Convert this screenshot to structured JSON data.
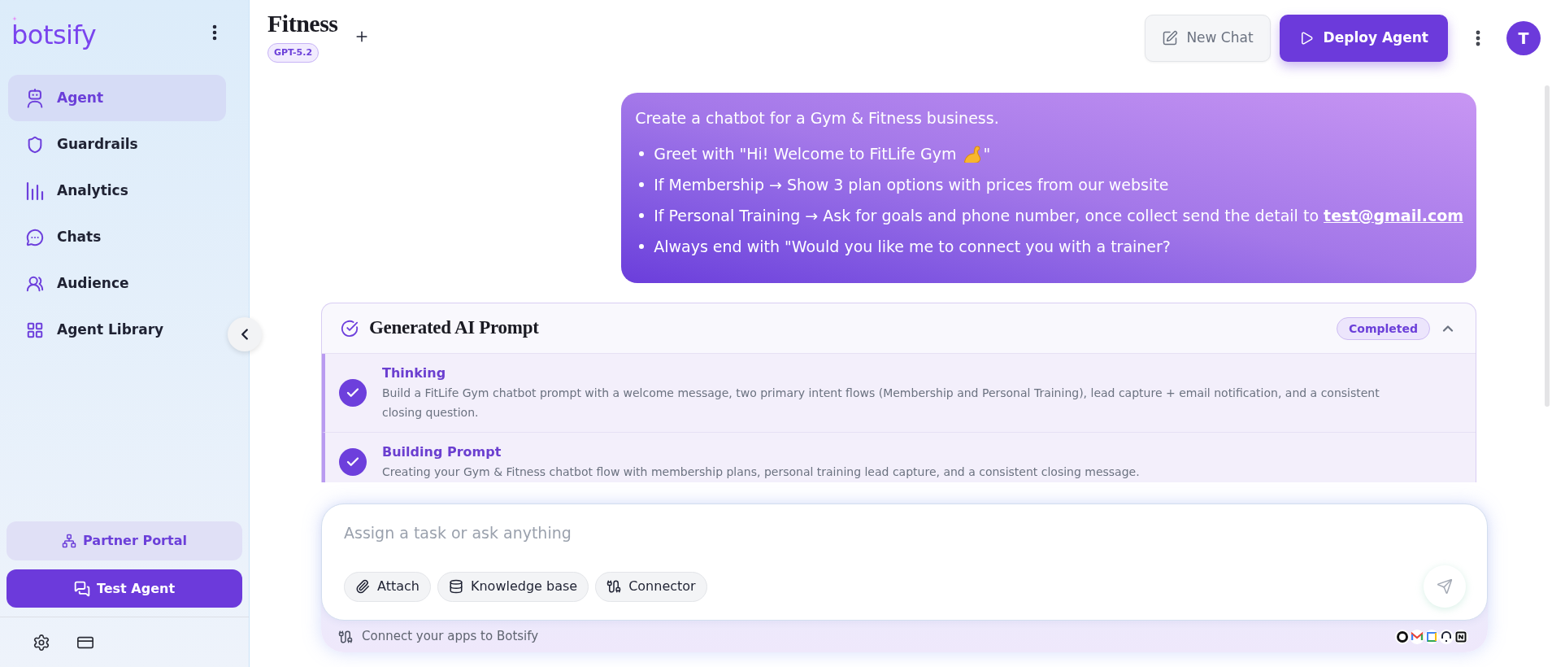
{
  "sidebar": {
    "logo": "botsify",
    "nav": [
      {
        "label": "Agent",
        "kind": "agent",
        "selected": true
      },
      {
        "label": "Guardrails",
        "kind": "guardrails",
        "selected": false
      },
      {
        "label": "Analytics",
        "kind": "analytics",
        "selected": false
      },
      {
        "label": "Chats",
        "kind": "chats",
        "selected": false
      },
      {
        "label": "Audience",
        "kind": "audience",
        "selected": false
      },
      {
        "label": "Agent Library",
        "kind": "library",
        "selected": false
      }
    ],
    "partner_button": "Partner Portal",
    "test_button": "Test Agent"
  },
  "header": {
    "title": "Fitness",
    "model": "GPT-5.2",
    "actions": [
      {
        "label": "New Chat",
        "kind": "secondary"
      },
      {
        "label": "Deploy Agent",
        "kind": "primary"
      }
    ],
    "avatar": "T"
  },
  "message": {
    "intro": "Create a chatbot for a Gym & Fitness business.",
    "bullets": [
      {
        "kind": "emoji",
        "text": "Greet with \"Hi! Welcome to FitLife Gym",
        "after": "\""
      },
      {
        "kind": "plain",
        "text": "If Membership → Show 3 plan options with prices from our website"
      },
      {
        "kind": "link",
        "text": "If Personal Training → Ask for goals and phone number, once collect send the detail to",
        "link": "test@gmail.com"
      },
      {
        "kind": "plain",
        "text": "Always end with \"Would you like me to connect you with a trainer?"
      }
    ]
  },
  "prompt_card": {
    "title": "Generated AI Prompt",
    "status": "Completed",
    "expanded": true,
    "steps": [
      {
        "title": "Thinking",
        "description": "Build a FitLife Gym chatbot prompt with a welcome message, two primary intent flows (Membership and Personal Training), lead capture + email notification, and a consistent closing question.",
        "done": true
      },
      {
        "title": "Building Prompt",
        "description": "Creating your Gym & Fitness chatbot flow with membership plans, personal training lead capture, and a consistent closing message.",
        "done": true
      }
    ]
  },
  "composer": {
    "placeholder": "Assign a task or ask anything",
    "chips": [
      {
        "label": "Attach",
        "kind": "attach"
      },
      {
        "label": "Knowledge base",
        "kind": "knowledge"
      },
      {
        "label": "Connector",
        "kind": "connector"
      }
    ],
    "footer": "Connect your apps to Botsify"
  }
}
